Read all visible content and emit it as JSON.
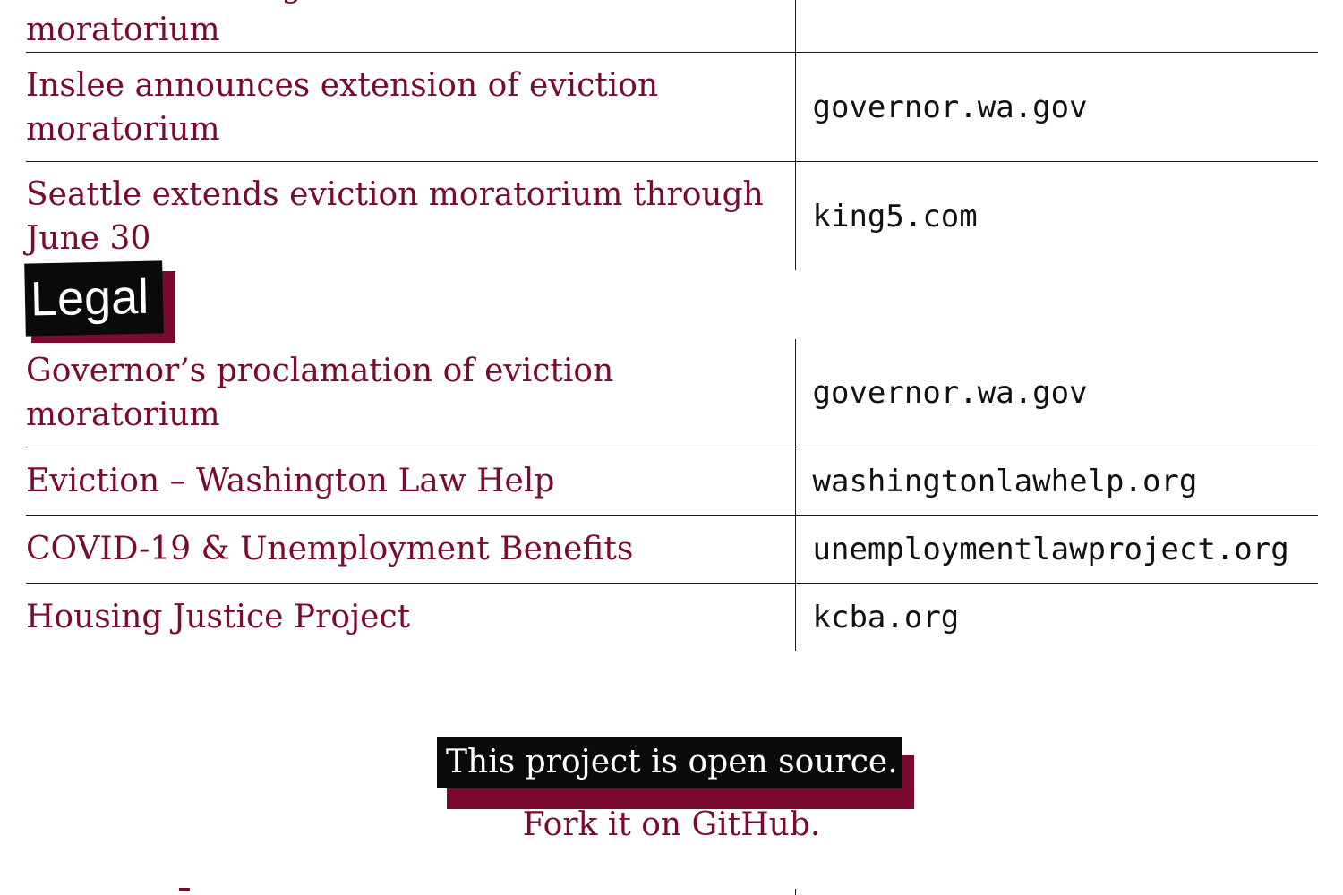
{
  "previous_section": {
    "rows": [
      {
        "title": "Seattle renters get some relief with eviction moratorium",
        "source": ""
      },
      {
        "title": "Inslee announces extension of eviction moratorium",
        "source": "governor.wa.gov"
      },
      {
        "title": "Seattle extends eviction moratorium through June 30",
        "source": "king5.com"
      }
    ]
  },
  "legal_section": {
    "heading": "Legal",
    "rows": [
      {
        "title": "Governor’s proclamation of eviction moratorium",
        "source": "governor.wa.gov"
      },
      {
        "title": "Eviction – Washington Law Help",
        "source": "washingtonlawhelp.org"
      },
      {
        "title": "COVID-19 & Unemployment Benefits",
        "source": "unemploymentlawproject.org"
      },
      {
        "title": "Housing Justice Project",
        "source": "kcba.org"
      }
    ]
  },
  "footer": {
    "open_source_text": "This project is open source.",
    "fork_link_text": "Fork it on GitHub."
  },
  "colors": {
    "link": "#7a0a2f",
    "badge_bg": "#0a0a0a",
    "badge_shadow": "#7a0a2f",
    "rule": "#1a1a1a"
  }
}
